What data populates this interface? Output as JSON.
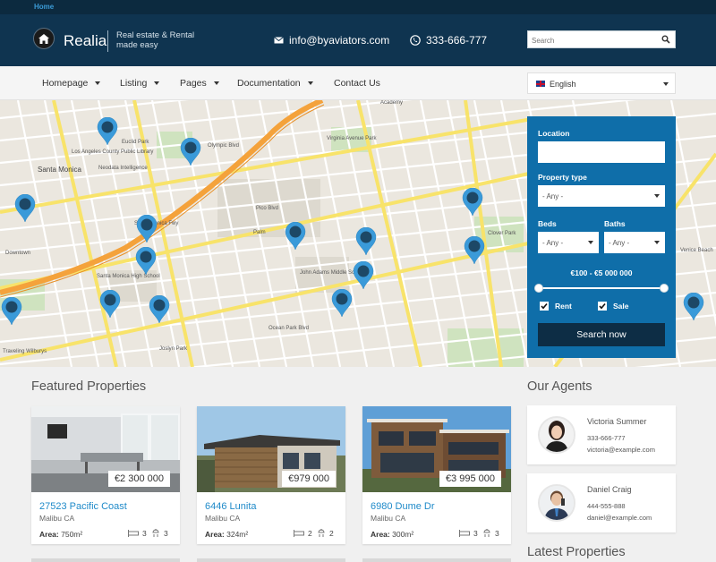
{
  "breadcrumb": "Home",
  "header": {
    "logo_text": "Realia",
    "tagline": "Real estate & Rental made easy",
    "email": "info@byaviators.com",
    "phone": "333-666-777",
    "search_placeholder": "Search"
  },
  "nav": {
    "items": [
      {
        "label": "Homepage",
        "dropdown": true
      },
      {
        "label": "Listing",
        "dropdown": true
      },
      {
        "label": "Pages",
        "dropdown": true
      },
      {
        "label": "Documentation",
        "dropdown": true
      },
      {
        "label": "Contact Us",
        "dropdown": false
      }
    ],
    "language": "English"
  },
  "map": {
    "labels": [
      "Santa Monica",
      "Downtown",
      "Santa Monica High School",
      "John Adams Middle School",
      "Clover Park",
      "Virginia Avenue Park",
      "Neodata Intelligence",
      "Los Angeles County Public Library",
      "Euclid Park",
      "Palm",
      "Pico Blvd",
      "Ocean Park Blvd",
      "Olympic Blvd",
      "Santa Monica Fwy",
      "Venice Beach",
      "Joslyn Park",
      "Traveling Wilburys",
      "Academy"
    ]
  },
  "search_panel": {
    "location_label": "Location",
    "property_type_label": "Property type",
    "property_type_value": "- Any -",
    "beds_label": "Beds",
    "beds_value": "- Any -",
    "baths_label": "Baths",
    "baths_value": "- Any -",
    "price_range": "€100 - €5 000 000",
    "price_min_fraction": 0,
    "price_max_fraction": 1,
    "rent_label": "Rent",
    "rent_checked": true,
    "sale_label": "Sale",
    "sale_checked": true,
    "button_label": "Search now"
  },
  "featured": {
    "title": "Featured Properties",
    "properties": [
      {
        "price": "€2 300 000",
        "title": "27523 Pacific Coast",
        "location": "Malibu CA",
        "area_label": "Area:",
        "area": "750m²",
        "beds": "3",
        "baths": "3"
      },
      {
        "price": "€979 000",
        "title": "6446 Lunita",
        "location": "Malibu CA",
        "area_label": "Area:",
        "area": "324m²",
        "beds": "2",
        "baths": "2"
      },
      {
        "price": "€3 995 000",
        "title": "6980 Dume Dr",
        "location": "Malibu CA",
        "area_label": "Area:",
        "area": "300m²",
        "beds": "3",
        "baths": "3"
      }
    ]
  },
  "agents": {
    "title": "Our Agents",
    "list": [
      {
        "name": "Victoria Summer",
        "phone": "333-666-777",
        "email": "victoria@example.com"
      },
      {
        "name": "Daniel Craig",
        "phone": "444-555-888",
        "email": "daniel@example.com"
      }
    ]
  },
  "latest": {
    "title": "Latest Properties"
  },
  "colors": {
    "header": "#0f3450",
    "panel": "#0f6ea9",
    "link": "#1f8ac9",
    "pin": "#3a9ad9"
  }
}
